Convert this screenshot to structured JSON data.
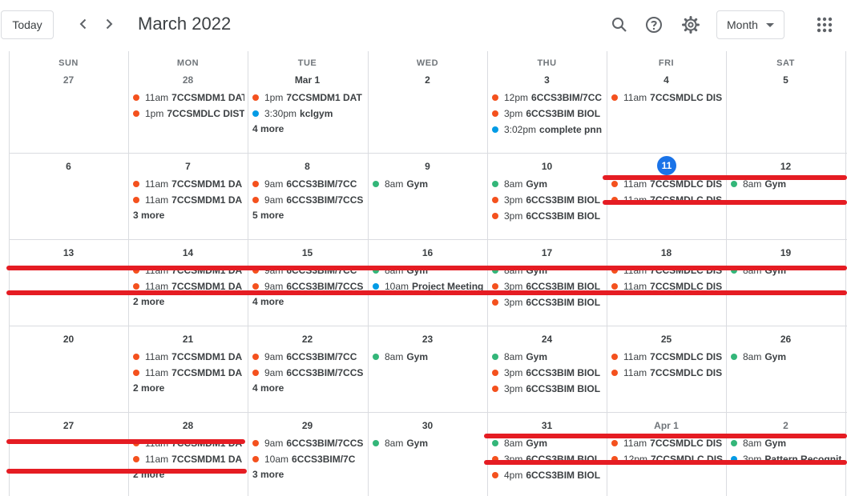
{
  "header": {
    "today_label": "Today",
    "title": "March 2022",
    "view_label": "Month"
  },
  "colors": {
    "orange": "#f4511e",
    "blue": "#039be5",
    "green": "#33b679",
    "today_blue": "#1a73e8",
    "annotation_red": "#e51c23"
  },
  "weekdays": [
    "SUN",
    "MON",
    "TUE",
    "WED",
    "THU",
    "FRI",
    "SAT"
  ],
  "weeks": [
    {
      "days": [
        {
          "num": "27",
          "other": true,
          "events": []
        },
        {
          "num": "28",
          "other": true,
          "events": [
            {
              "color": "orange",
              "time": "11am",
              "title": "7CCSMDM1 DATA"
            },
            {
              "color": "orange",
              "time": "1pm",
              "title": "7CCSMDLC DIST"
            }
          ]
        },
        {
          "num": "Mar 1",
          "events": [
            {
              "color": "orange",
              "time": "1pm",
              "title": "7CCSMDM1 DAT"
            },
            {
              "color": "blue",
              "time": "3:30pm",
              "title": "kclgym"
            }
          ],
          "more": "4 more"
        },
        {
          "num": "2",
          "events": []
        },
        {
          "num": "3",
          "events": [
            {
              "color": "orange",
              "time": "12pm",
              "title": "6CCS3BIM/7CC"
            },
            {
              "color": "orange",
              "time": "3pm",
              "title": "6CCS3BIM BIOL"
            },
            {
              "color": "blue",
              "time": "3:02pm",
              "title": "complete pnn"
            }
          ]
        },
        {
          "num": "4",
          "events": [
            {
              "color": "orange",
              "time": "11am",
              "title": "7CCSMDLC DIS"
            }
          ]
        },
        {
          "num": "5",
          "events": []
        }
      ]
    },
    {
      "days": [
        {
          "num": "6",
          "events": []
        },
        {
          "num": "7",
          "events": [
            {
              "color": "orange",
              "time": "11am",
              "title": "7CCSMDM1 DA"
            },
            {
              "color": "orange",
              "time": "11am",
              "title": "7CCSMDM1 DA"
            }
          ],
          "more": "3 more"
        },
        {
          "num": "8",
          "events": [
            {
              "color": "orange",
              "time": "9am",
              "title": "6CCS3BIM/7CC"
            },
            {
              "color": "orange",
              "time": "9am",
              "title": "6CCS3BIM/7CCS"
            }
          ],
          "more": "5 more"
        },
        {
          "num": "9",
          "events": [
            {
              "color": "green",
              "time": "8am",
              "title": "Gym"
            }
          ]
        },
        {
          "num": "10",
          "events": [
            {
              "color": "green",
              "time": "8am",
              "title": "Gym"
            },
            {
              "color": "orange",
              "time": "3pm",
              "title": "6CCS3BIM BIOL"
            },
            {
              "color": "orange",
              "time": "3pm",
              "title": "6CCS3BIM BIOL"
            }
          ]
        },
        {
          "num": "11",
          "today": true,
          "events": [
            {
              "color": "orange",
              "time": "11am",
              "title": "7CCSMDLC DIS"
            },
            {
              "color": "orange",
              "time": "11am",
              "title": "7CCSMDLC DIS"
            }
          ]
        },
        {
          "num": "12",
          "events": [
            {
              "color": "green",
              "time": "8am",
              "title": "Gym"
            }
          ]
        }
      ]
    },
    {
      "days": [
        {
          "num": "13",
          "events": []
        },
        {
          "num": "14",
          "events": [
            {
              "color": "orange",
              "time": "11am",
              "title": "7CCSMDM1 DA"
            },
            {
              "color": "orange",
              "time": "11am",
              "title": "7CCSMDM1 DA"
            }
          ],
          "more": "2 more"
        },
        {
          "num": "15",
          "events": [
            {
              "color": "orange",
              "time": "9am",
              "title": "6CCS3BIM/7CC"
            },
            {
              "color": "orange",
              "time": "9am",
              "title": "6CCS3BIM/7CCS"
            }
          ],
          "more": "4 more"
        },
        {
          "num": "16",
          "events": [
            {
              "color": "green",
              "time": "8am",
              "title": "Gym"
            },
            {
              "color": "blue",
              "time": "10am",
              "title": "Project Meeting"
            }
          ]
        },
        {
          "num": "17",
          "events": [
            {
              "color": "green",
              "time": "8am",
              "title": "Gym"
            },
            {
              "color": "orange",
              "time": "3pm",
              "title": "6CCS3BIM BIOL"
            },
            {
              "color": "orange",
              "time": "3pm",
              "title": "6CCS3BIM BIOL"
            }
          ]
        },
        {
          "num": "18",
          "events": [
            {
              "color": "orange",
              "time": "11am",
              "title": "7CCSMDLC DIS"
            },
            {
              "color": "orange",
              "time": "11am",
              "title": "7CCSMDLC DIS"
            }
          ]
        },
        {
          "num": "19",
          "events": [
            {
              "color": "green",
              "time": "8am",
              "title": "Gym"
            }
          ]
        }
      ]
    },
    {
      "days": [
        {
          "num": "20",
          "events": []
        },
        {
          "num": "21",
          "events": [
            {
              "color": "orange",
              "time": "11am",
              "title": "7CCSMDM1 DA"
            },
            {
              "color": "orange",
              "time": "11am",
              "title": "7CCSMDM1 DA"
            }
          ],
          "more": "2 more"
        },
        {
          "num": "22",
          "events": [
            {
              "color": "orange",
              "time": "9am",
              "title": "6CCS3BIM/7CC"
            },
            {
              "color": "orange",
              "time": "9am",
              "title": "6CCS3BIM/7CCS"
            }
          ],
          "more": "4 more"
        },
        {
          "num": "23",
          "events": [
            {
              "color": "green",
              "time": "8am",
              "title": "Gym"
            }
          ]
        },
        {
          "num": "24",
          "events": [
            {
              "color": "green",
              "time": "8am",
              "title": "Gym"
            },
            {
              "color": "orange",
              "time": "3pm",
              "title": "6CCS3BIM BIOL"
            },
            {
              "color": "orange",
              "time": "3pm",
              "title": "6CCS3BIM BIOL"
            }
          ]
        },
        {
          "num": "25",
          "events": [
            {
              "color": "orange",
              "time": "11am",
              "title": "7CCSMDLC DIS"
            },
            {
              "color": "orange",
              "time": "11am",
              "title": "7CCSMDLC DIS"
            }
          ]
        },
        {
          "num": "26",
          "events": [
            {
              "color": "green",
              "time": "8am",
              "title": "Gym"
            }
          ]
        }
      ]
    },
    {
      "days": [
        {
          "num": "27",
          "events": []
        },
        {
          "num": "28",
          "events": [
            {
              "color": "orange",
              "time": "11am",
              "title": "7CCSMDM1 DA"
            },
            {
              "color": "orange",
              "time": "11am",
              "title": "7CCSMDM1 DA"
            }
          ],
          "more": "2 more"
        },
        {
          "num": "29",
          "events": [
            {
              "color": "orange",
              "time": "9am",
              "title": "6CCS3BIM/7CCS"
            },
            {
              "color": "orange",
              "time": "10am",
              "title": "6CCS3BIM/7C"
            }
          ],
          "more": "3 more"
        },
        {
          "num": "30",
          "events": [
            {
              "color": "green",
              "time": "8am",
              "title": "Gym"
            }
          ]
        },
        {
          "num": "31",
          "events": [
            {
              "color": "green",
              "time": "8am",
              "title": "Gym"
            },
            {
              "color": "orange",
              "time": "3pm",
              "title": "6CCS3BIM BIOL"
            },
            {
              "color": "orange",
              "time": "4pm",
              "title": "6CCS3BIM BIOL"
            }
          ]
        },
        {
          "num": "Apr 1",
          "other": true,
          "events": [
            {
              "color": "orange",
              "time": "11am",
              "title": "7CCSMDLC DIS"
            },
            {
              "color": "orange",
              "time": "12pm",
              "title": "7CCSMDLC DIS"
            }
          ]
        },
        {
          "num": "2",
          "other": true,
          "events": [
            {
              "color": "green",
              "time": "8am",
              "title": "Gym"
            },
            {
              "color": "blue",
              "time": "3pm",
              "title": "Pattern Recognit"
            }
          ]
        }
      ]
    }
  ]
}
